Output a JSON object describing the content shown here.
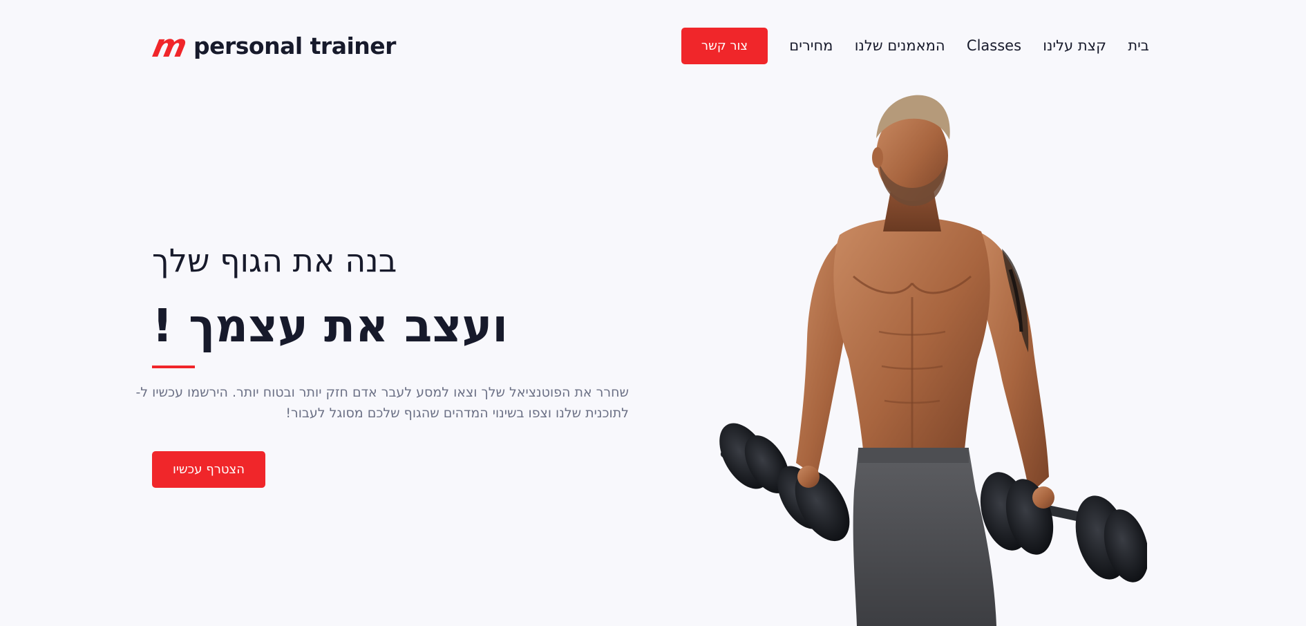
{
  "brand": {
    "logo_mark": "m",
    "name": "personal trainer",
    "accent_color": "#f0262a"
  },
  "nav": {
    "links": [
      "בית",
      "קצת עלינו",
      "Classes",
      "המאמנים שלנו",
      "מחירים"
    ],
    "contact_label": "צור קשר"
  },
  "hero": {
    "subtitle": "בנה את הגוף שלך",
    "title": "ועצב את עצמך !",
    "description_line1": "שחרר את הפוטנציאל שלך וצאו למסע לעבר אדם חזק יותר ובטוח יותר. הירשמו עכשיו ל-",
    "description_line2": "לתוכנית שלנו וצפו בשינוי המדהים שהגוף שלכם מסוגל לעבור!",
    "join_label": "הצטרף עכשיו",
    "image_icon": "muscular-man-with-dumbbells-photo"
  }
}
